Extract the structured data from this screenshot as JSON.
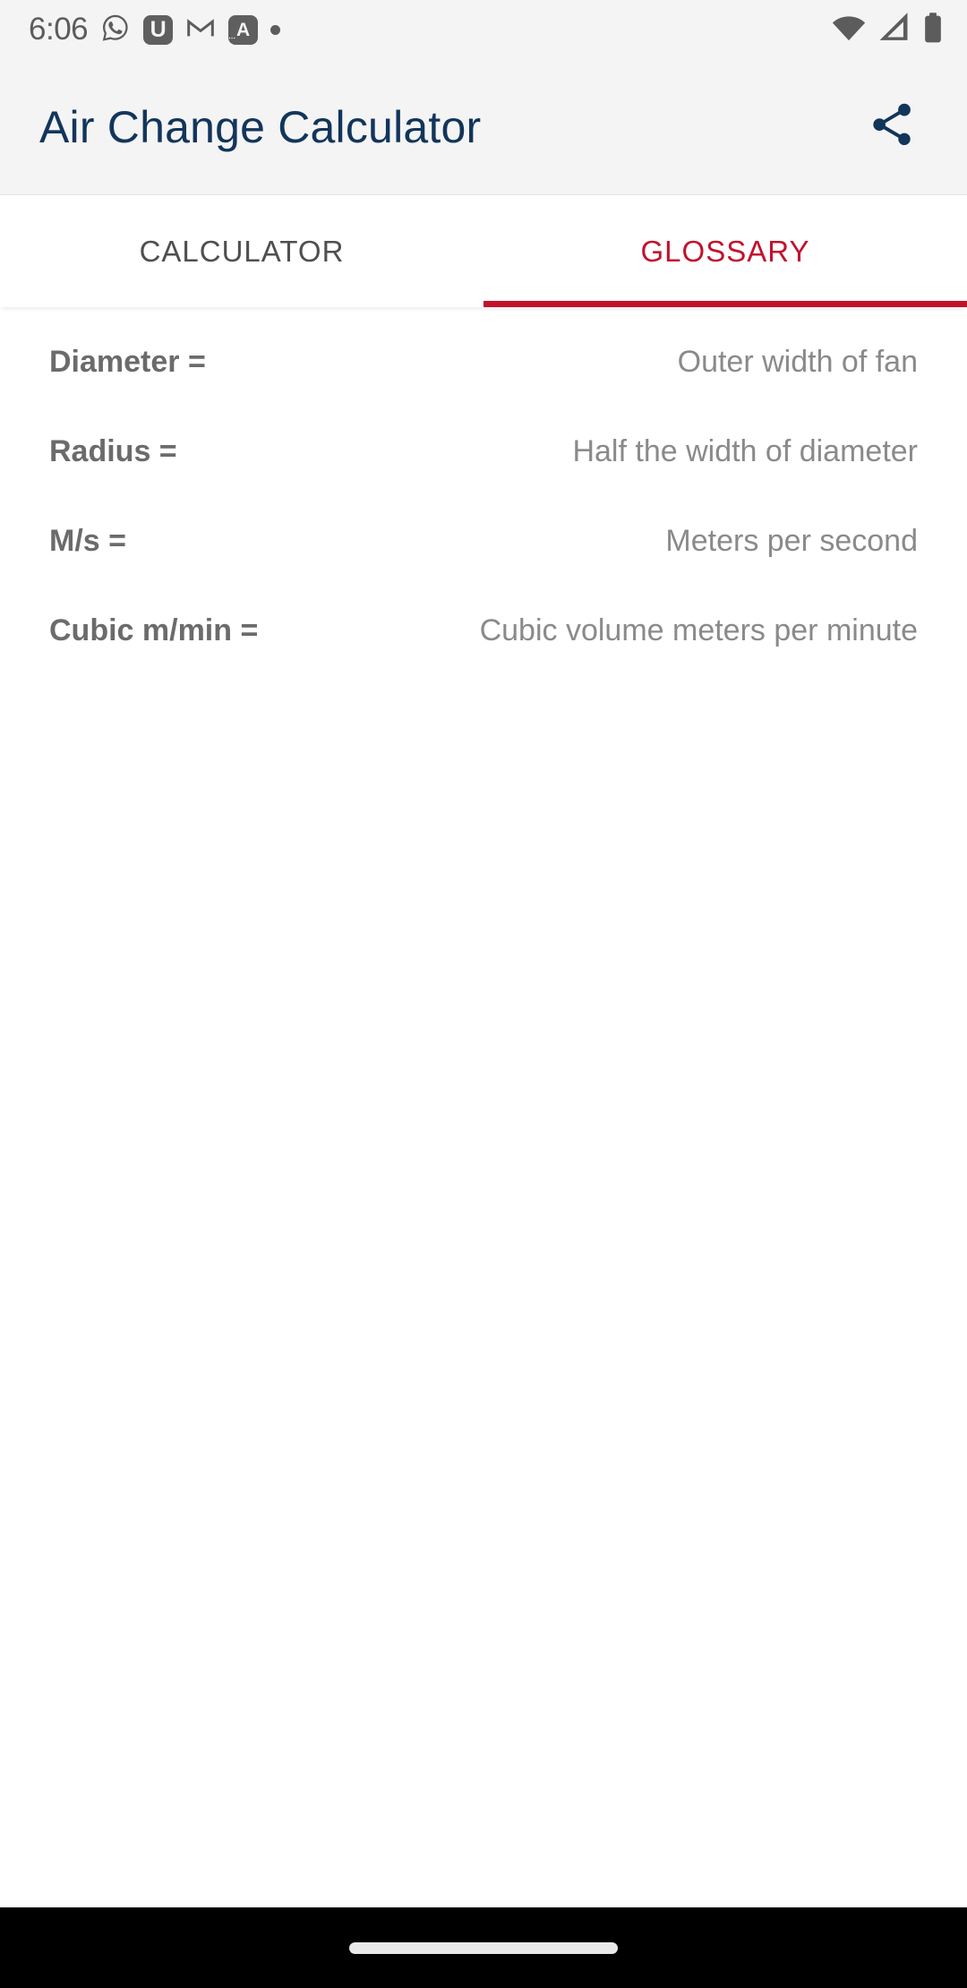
{
  "status_bar": {
    "time": "6:06",
    "left_icons": [
      {
        "name": "whatsapp-icon",
        "glyph": "whatsapp"
      },
      {
        "name": "app-badge-u-icon",
        "label": "U"
      },
      {
        "name": "gmail-icon",
        "glyph": "gmail"
      },
      {
        "name": "app-badge-a-icon",
        "label": "A"
      },
      {
        "name": "notification-dot-icon",
        "glyph": "dot"
      }
    ],
    "right_icons": [
      {
        "name": "wifi-icon",
        "state": "full"
      },
      {
        "name": "cellular-signal-icon",
        "state": "partial"
      },
      {
        "name": "battery-icon",
        "state": "full"
      }
    ]
  },
  "app_bar": {
    "title": "Air Change Calculator",
    "share_icon": "share-icon",
    "title_color": "#12355b"
  },
  "tabs": {
    "items": [
      {
        "label": "CALCULATOR",
        "active": false
      },
      {
        "label": "GLOSSARY",
        "active": true
      }
    ],
    "active_index": 1,
    "active_color": "#c2122e",
    "inactive_color": "#4f4f4f"
  },
  "glossary": {
    "rows": [
      {
        "term": "Diameter =",
        "definition": "Outer width of fan"
      },
      {
        "term": "Radius =",
        "definition": "Half the width of diameter"
      },
      {
        "term": "M/s =",
        "definition": "Meters per second"
      },
      {
        "term": "Cubic m/min =",
        "definition": "Cubic volume meters per minute"
      }
    ]
  },
  "nav_bar": {
    "gesture_pill": "home-gesture-pill"
  }
}
